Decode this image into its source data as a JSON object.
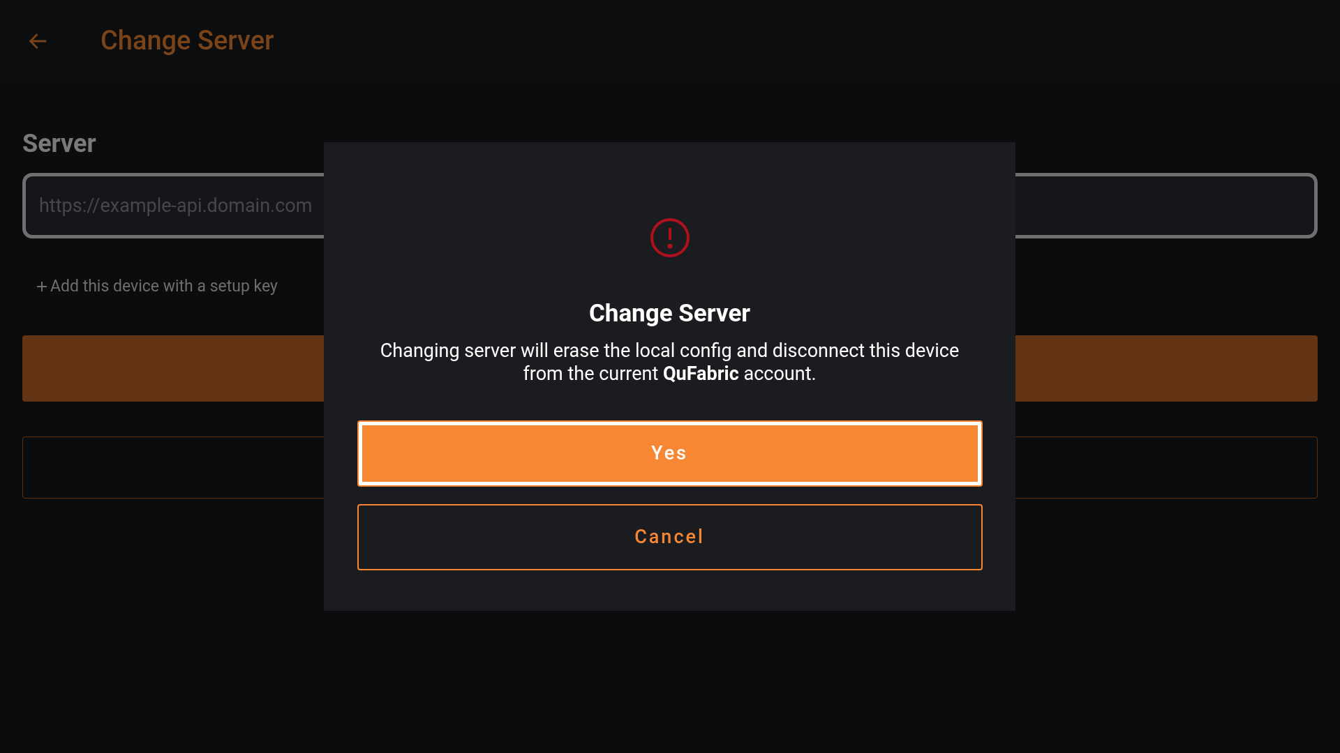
{
  "header": {
    "title": "Change Server"
  },
  "form": {
    "label": "Server",
    "server_field": {
      "placeholder": "https://example-api.domain.com"
    },
    "setup_key_link": "Add this device with a setup key"
  },
  "dialog": {
    "title": "Change Server",
    "message": "Changing server will erase the local config and disconnect this device from the current **QuFabric** account.",
    "buttons": [
      {
        "label": "Yes",
        "kind": "primary",
        "focused": true
      },
      {
        "label": "Cancel",
        "kind": "outline",
        "focused": false
      }
    ]
  }
}
